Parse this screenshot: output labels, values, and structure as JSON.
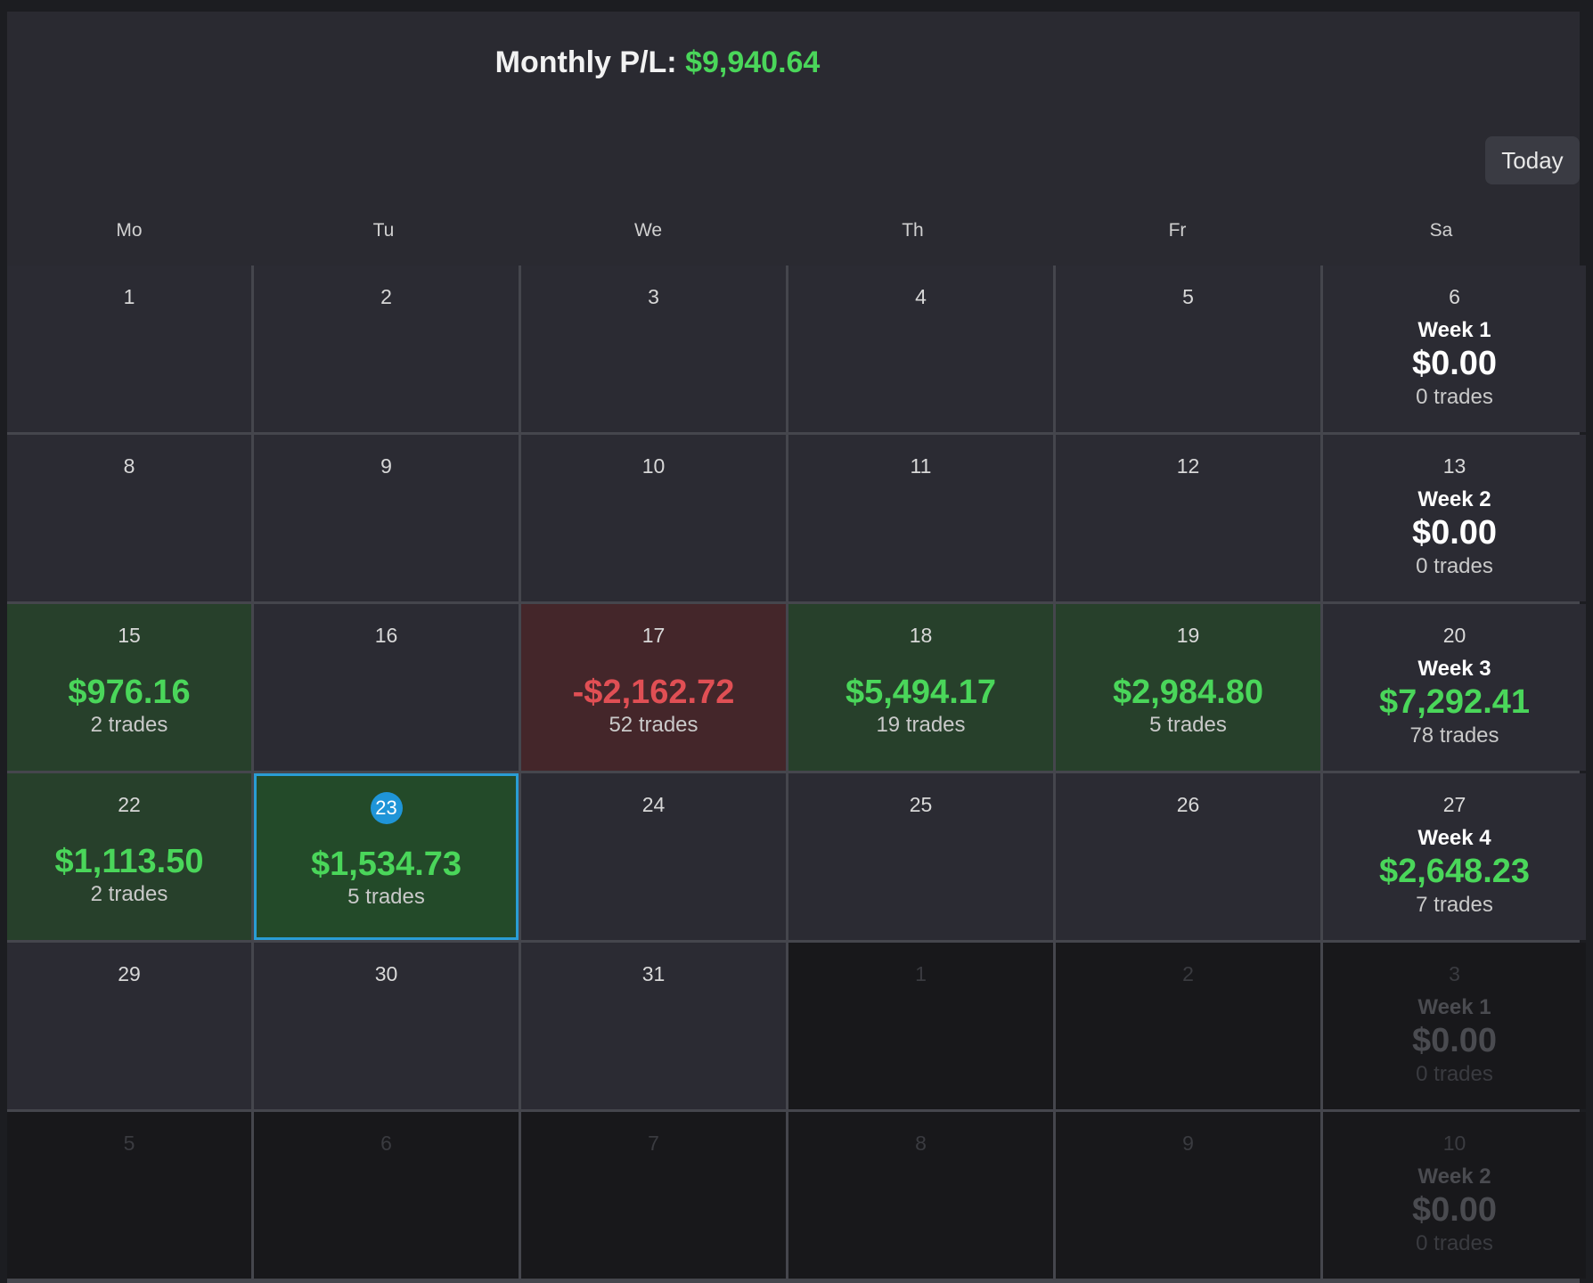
{
  "header": {
    "monthly_label": "Monthly P/L:",
    "monthly_value": "$9,940.64",
    "today_button": "Today"
  },
  "weekdays": [
    "Mo",
    "Tu",
    "We",
    "Th",
    "Fr",
    "Sa"
  ],
  "weeks": [
    {
      "days": [
        {
          "day": "1"
        },
        {
          "day": "2"
        },
        {
          "day": "3"
        },
        {
          "day": "4"
        },
        {
          "day": "5"
        }
      ],
      "summary": {
        "day": "6",
        "label": "Week 1",
        "pl": "$0.00",
        "trades": "0 trades",
        "status": "neutral"
      }
    },
    {
      "days": [
        {
          "day": "8"
        },
        {
          "day": "9"
        },
        {
          "day": "10"
        },
        {
          "day": "11"
        },
        {
          "day": "12"
        }
      ],
      "summary": {
        "day": "13",
        "label": "Week 2",
        "pl": "$0.00",
        "trades": "0 trades",
        "status": "neutral"
      }
    },
    {
      "days": [
        {
          "day": "15",
          "pl": "$976.16",
          "trades": "2 trades",
          "status": "profit"
        },
        {
          "day": "16"
        },
        {
          "day": "17",
          "pl": "-$2,162.72",
          "trades": "52 trades",
          "status": "loss"
        },
        {
          "day": "18",
          "pl": "$5,494.17",
          "trades": "19 trades",
          "status": "profit"
        },
        {
          "day": "19",
          "pl": "$2,984.80",
          "trades": "5 trades",
          "status": "profit"
        }
      ],
      "summary": {
        "day": "20",
        "label": "Week 3",
        "pl": "$7,292.41",
        "trades": "78 trades",
        "status": "positive"
      }
    },
    {
      "days": [
        {
          "day": "22",
          "pl": "$1,113.50",
          "trades": "2 trades",
          "status": "profit"
        },
        {
          "day": "23",
          "pl": "$1,534.73",
          "trades": "5 trades",
          "status": "selected",
          "today": true
        },
        {
          "day": "24"
        },
        {
          "day": "25"
        },
        {
          "day": "26"
        }
      ],
      "summary": {
        "day": "27",
        "label": "Week 4",
        "pl": "$2,648.23",
        "trades": "7 trades",
        "status": "positive"
      }
    },
    {
      "days": [
        {
          "day": "29"
        },
        {
          "day": "30"
        },
        {
          "day": "31"
        },
        {
          "day": "1",
          "outside": true
        },
        {
          "day": "2",
          "outside": true
        }
      ],
      "summary": {
        "day": "3",
        "label": "Week 1",
        "pl": "$0.00",
        "trades": "0 trades",
        "status": "neutral",
        "outside": true
      }
    },
    {
      "days": [
        {
          "day": "5",
          "outside": true
        },
        {
          "day": "6",
          "outside": true
        },
        {
          "day": "7",
          "outside": true
        },
        {
          "day": "8",
          "outside": true
        },
        {
          "day": "9",
          "outside": true
        }
      ],
      "summary": {
        "day": "10",
        "label": "Week 2",
        "pl": "$0.00",
        "trades": "0 trades",
        "status": "neutral",
        "outside": true
      }
    }
  ]
}
